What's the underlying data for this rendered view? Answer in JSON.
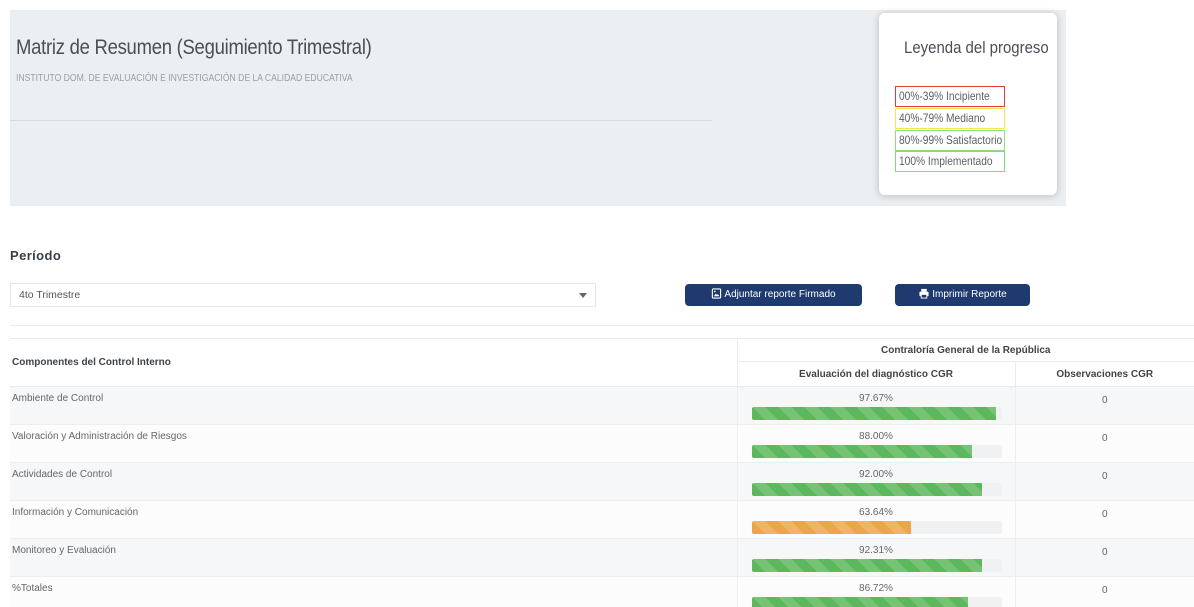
{
  "header": {
    "title": "Matriz de Resumen (Seguimiento Trimestral)",
    "subtitle": "INSTITUTO DOM. DE EVALUACIÓN E INVESTIGACIÓN DE LA CALIDAD EDUCATIVA"
  },
  "legend": {
    "title": "Leyenda del progreso",
    "items": [
      {
        "label": "00%-39% Incipiente",
        "color": "#e53935"
      },
      {
        "label": "40%-79% Mediano",
        "color": "#f2e94e"
      },
      {
        "label": "80%-99% Satisfactorio",
        "color": "#8fe07a"
      },
      {
        "label": "100% Implementado",
        "color": "#7fd97a"
      }
    ]
  },
  "period": {
    "label": "Período",
    "selected": "4to Trimestre"
  },
  "buttons": {
    "attach_label": "Adjuntar reporte Firmado",
    "print_label": "Imprimir Reporte"
  },
  "table": {
    "col_component": "Componentes del Control Interno",
    "group_header": "Contraloría General de la República",
    "col_eval": "Evaluación del diagnóstico CGR",
    "col_obs": "Observaciones CGR",
    "rows": [
      {
        "name": "Ambiente de Control",
        "pct": "97.67%",
        "progress": 97.67,
        "status": "green",
        "obs": "0"
      },
      {
        "name": "Valoración y Administración de Riesgos",
        "pct": "88.00%",
        "progress": 88.0,
        "status": "green",
        "obs": "0"
      },
      {
        "name": "Actividades de Control",
        "pct": "92.00%",
        "progress": 92.0,
        "status": "green",
        "obs": "0"
      },
      {
        "name": "Información y Comunicación",
        "pct": "63.64%",
        "progress": 63.64,
        "status": "orange",
        "obs": "0"
      },
      {
        "name": "Monitoreo y Evaluación",
        "pct": "92.31%",
        "progress": 92.31,
        "status": "green",
        "obs": "0"
      },
      {
        "name": "%Totales",
        "pct": "86.72%",
        "progress": 86.72,
        "status": "green",
        "obs": "0"
      }
    ]
  },
  "colors": {
    "primary_button": "#1e3a6e",
    "progress_green": "#5cb85c",
    "progress_orange": "#e8a849",
    "header_bg": "#eceff1"
  }
}
